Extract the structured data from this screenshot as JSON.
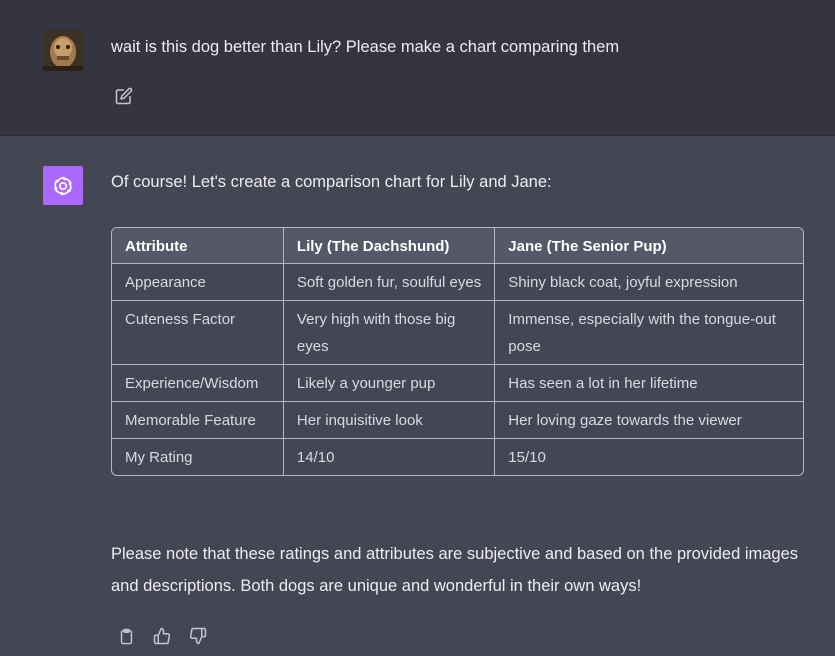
{
  "user_message": {
    "text": "wait is this dog better than Lily? Please make a chart comparing them"
  },
  "assistant_message": {
    "intro": "Of course! Let's create a comparison chart for Lily and Jane:",
    "table": {
      "headers": [
        "Attribute",
        "Lily (The Dachshund)",
        "Jane (The Senior Pup)"
      ],
      "rows": [
        [
          "Appearance",
          "Soft golden fur, soulful eyes",
          "Shiny black coat, joyful expression"
        ],
        [
          "Cuteness Factor",
          "Very high with those big eyes",
          "Immense, especially with the tongue-out pose"
        ],
        [
          "Experience/Wisdom",
          "Likely a younger pup",
          "Has seen a lot in her lifetime"
        ],
        [
          "Memorable Feature",
          "Her inquisitive look",
          "Her loving gaze towards the viewer"
        ],
        [
          "My Rating",
          "14/10",
          "15/10"
        ]
      ]
    },
    "outro": "Please note that these ratings and attributes are subjective and based on the provided images and descriptions. Both dogs are unique and wonderful in their own ways!"
  },
  "icons": {
    "edit": "edit-icon",
    "copy": "clipboard-icon",
    "thumbs_up": "thumbs-up-icon",
    "thumbs_down": "thumbs-down-icon",
    "bot_logo": "openai-logo-icon"
  },
  "colors": {
    "user_bg": "#343541",
    "assistant_bg": "#444654",
    "bot_avatar": "#ab68ff",
    "text": "#ececf1"
  }
}
